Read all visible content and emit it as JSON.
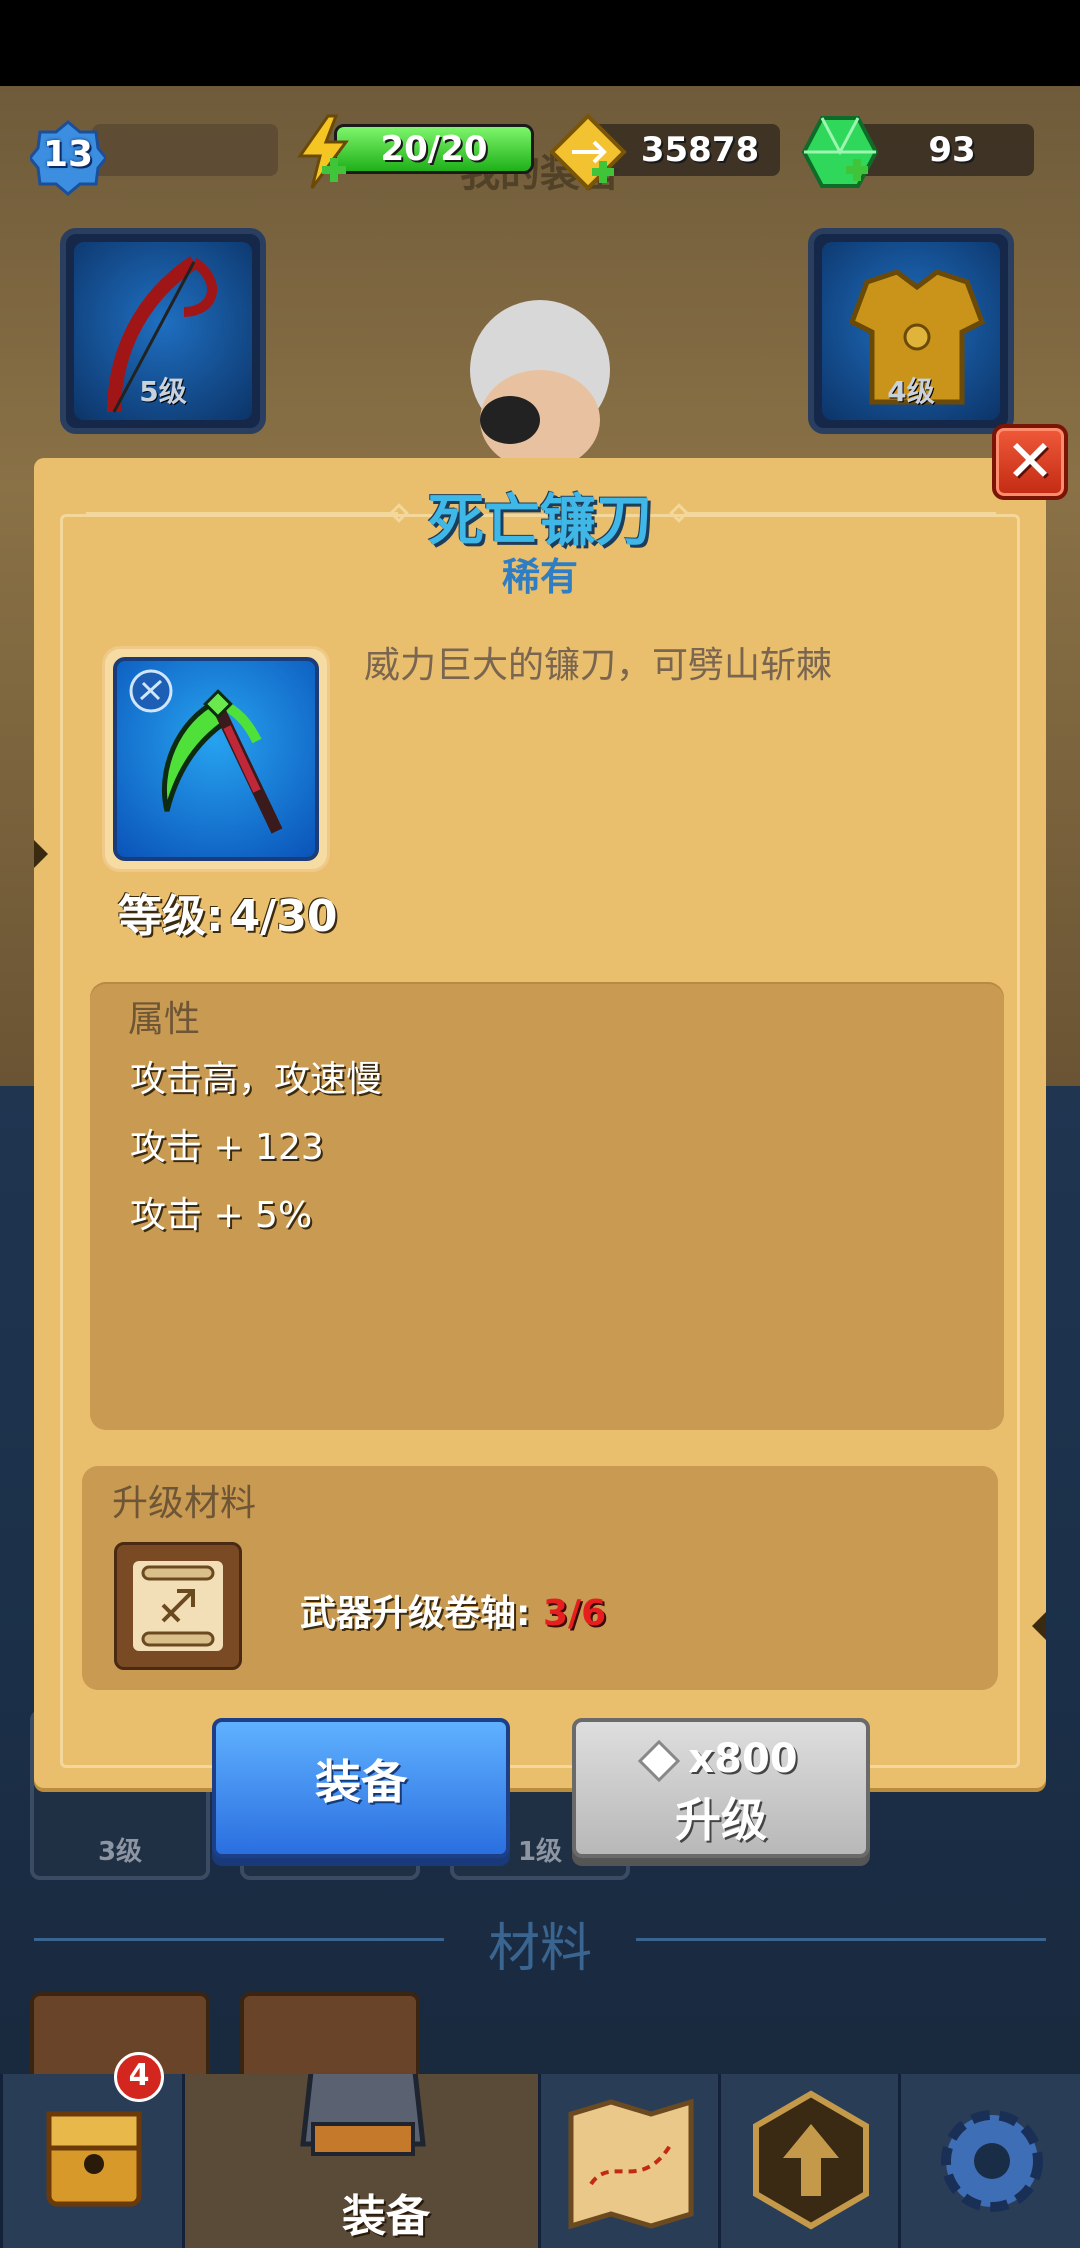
{
  "hud": {
    "player_level": "13",
    "energy": "20/20",
    "energy_fill": 1.0,
    "coins": "35878",
    "gems": "93"
  },
  "background": {
    "title": "我的装备",
    "weapon_slot_level": "5级",
    "armor_slot_level": "4级",
    "inventory": [
      {
        "level": "3级"
      },
      {
        "level": "1级"
      },
      {
        "level": "1级"
      }
    ],
    "materials_title": "材料",
    "chest_badge": "4",
    "nav": {
      "equipment_label": "装备"
    }
  },
  "modal": {
    "item_name": "死亡镰刀",
    "rarity": "稀有",
    "description": "威力巨大的镰刀，可劈山斩棘",
    "level_label": "等级:",
    "level_value": "4/30",
    "attributes_title": "属性",
    "attributes": [
      "攻击高，攻速慢",
      "攻击 + 123",
      "攻击 + 5%"
    ],
    "materials_title": "升级材料",
    "material_name": "武器升级卷轴:",
    "material_count": "3/6",
    "equip_button": "装备",
    "upgrade_cost": "x800",
    "upgrade_button": "升级"
  },
  "colors": {
    "modal_bg": "#e9bf6d",
    "rarity_blue": "#2f7ec4",
    "equip_blue": "#2b6fe0",
    "insufficient_red": "#e61e1e"
  }
}
